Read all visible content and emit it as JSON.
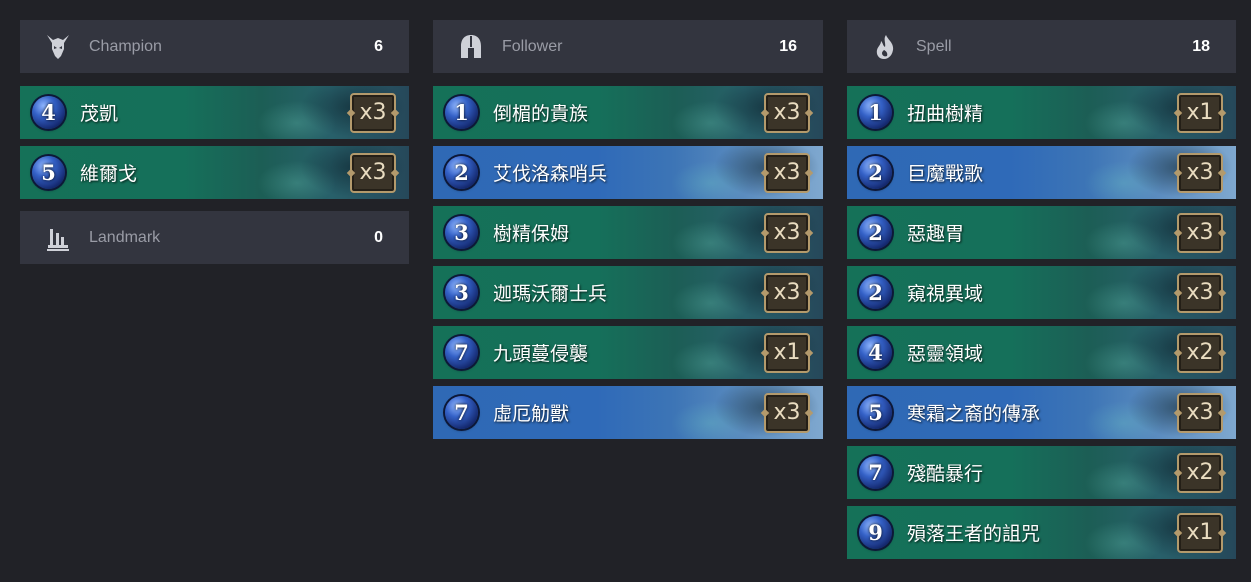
{
  "columns": {
    "champion": {
      "header": {
        "label": "Champion",
        "count": "6",
        "icon": "champion-icon"
      },
      "cards": [
        {
          "cost": "4",
          "name": "茂凱",
          "qty": "x3",
          "region_color": "green"
        },
        {
          "cost": "5",
          "name": "維爾戈",
          "qty": "x3",
          "region_color": "green"
        }
      ]
    },
    "landmark": {
      "header": {
        "label": "Landmark",
        "count": "0",
        "icon": "landmark-icon"
      }
    },
    "follower": {
      "header": {
        "label": "Follower",
        "count": "16",
        "icon": "follower-helmet-icon"
      },
      "cards": [
        {
          "cost": "1",
          "name": "倒楣的貴族",
          "qty": "x3",
          "region_color": "green"
        },
        {
          "cost": "2",
          "name": "艾伐洛森哨兵",
          "qty": "x3",
          "region_color": "blue"
        },
        {
          "cost": "3",
          "name": "樹精保姆",
          "qty": "x3",
          "region_color": "green"
        },
        {
          "cost": "3",
          "name": "迦瑪沃爾士兵",
          "qty": "x3",
          "region_color": "green"
        },
        {
          "cost": "7",
          "name": "九頭蔓侵襲",
          "qty": "x1",
          "region_color": "green"
        },
        {
          "cost": "7",
          "name": "虛厄觔獸",
          "qty": "x3",
          "region_color": "blue"
        }
      ]
    },
    "spell": {
      "header": {
        "label": "Spell",
        "count": "18",
        "icon": "spell-flame-icon"
      },
      "cards": [
        {
          "cost": "1",
          "name": "扭曲樹精",
          "qty": "x1",
          "region_color": "green"
        },
        {
          "cost": "2",
          "name": "巨魔戰歌",
          "qty": "x3",
          "region_color": "blue"
        },
        {
          "cost": "2",
          "name": "惡趣胃",
          "qty": "x3",
          "region_color": "green"
        },
        {
          "cost": "2",
          "name": "窺視異域",
          "qty": "x3",
          "region_color": "green"
        },
        {
          "cost": "4",
          "name": "惡靈領域",
          "qty": "x2",
          "region_color": "green"
        },
        {
          "cost": "5",
          "name": "寒霜之裔的傳承",
          "qty": "x3",
          "region_color": "blue"
        },
        {
          "cost": "7",
          "name": "殘酷暴行",
          "qty": "x2",
          "region_color": "green"
        },
        {
          "cost": "9",
          "name": "殞落王者的詛咒",
          "qty": "x1",
          "region_color": "green"
        }
      ]
    }
  },
  "colors": {
    "background": "#212227",
    "header_bg": "#33353f",
    "green_region": "#157158",
    "blue_region": "#2f69b5"
  }
}
